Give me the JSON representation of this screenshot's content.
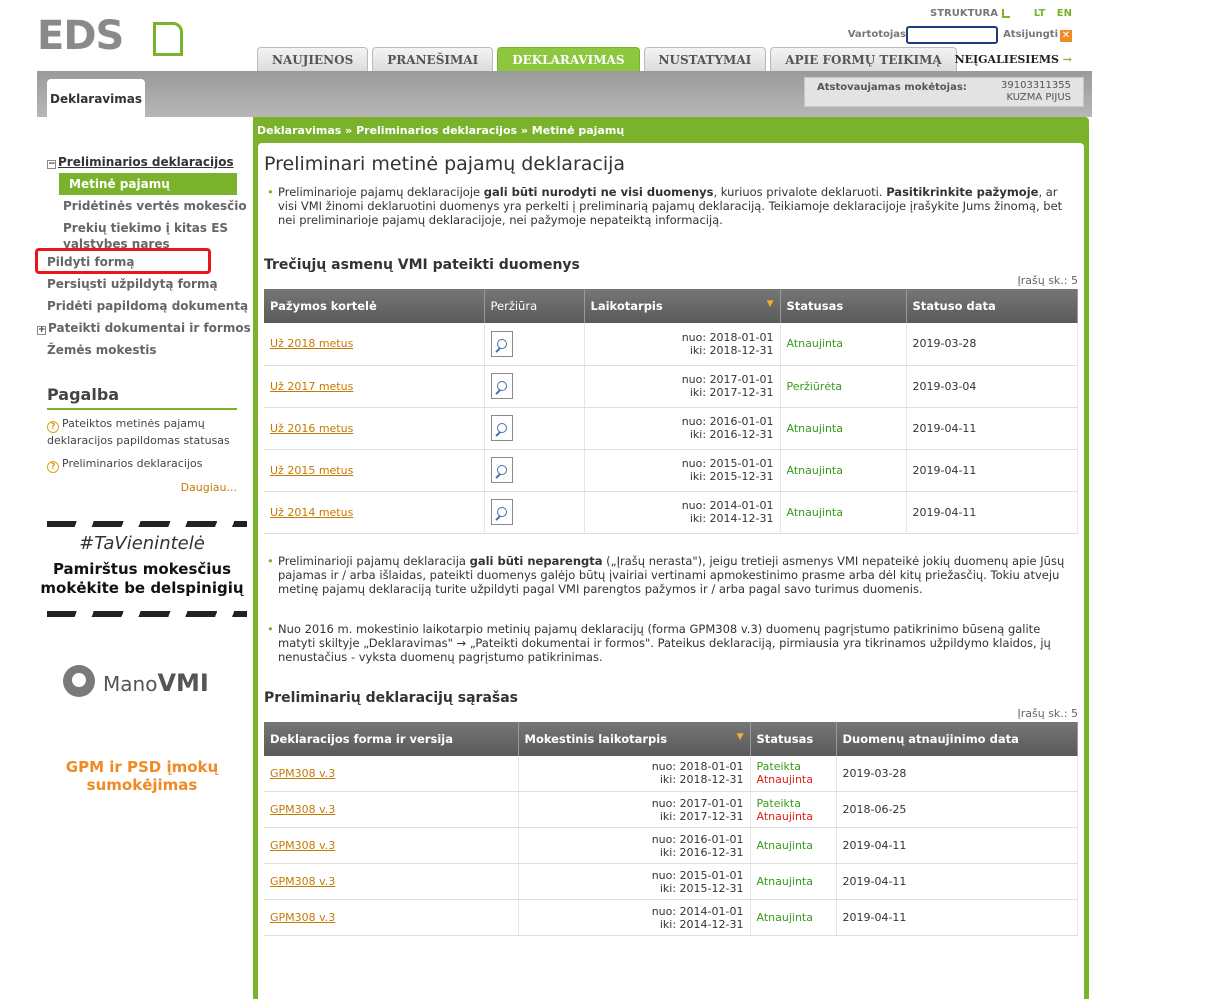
{
  "header": {
    "logo_text": "EDS",
    "struktura": "STRUKTURA",
    "lang_lt": "LT",
    "lang_en": "EN",
    "user_label": "Vartotojas",
    "logout": "Atsijungti",
    "tabs": [
      "NAUJIENOS",
      "PRANEŠIMAI",
      "DEKLARAVIMAS",
      "NUSTATYMAI",
      "APIE FORMŲ TEIKIMĄ"
    ],
    "active_tab": "DEKLARAVIMAS",
    "neigaliesiems": "NEĮGALIESIEMS"
  },
  "band": {
    "tab": "Deklaravimas",
    "payer_label": "Atstovaujamas mokėtojas:",
    "payer_id": "39103311355",
    "payer_name": "KUZMA PIJUS"
  },
  "sidebar": {
    "items": [
      {
        "label": "Preliminarios deklaracijos",
        "type": "top",
        "toggle": "−"
      },
      {
        "label": "Metinė pajamų",
        "type": "active"
      },
      {
        "label": "Pridėtinės vertės mokesčio",
        "type": "sub"
      },
      {
        "label": "Prekių tiekimo į kitas ES valstybes nares",
        "type": "sub"
      },
      {
        "label": "Pildyti formą",
        "type": "plain"
      },
      {
        "label": "Persiųsti užpildytą formą",
        "type": "plain"
      },
      {
        "label": "Pridėti papildomą dokumentą",
        "type": "plain"
      },
      {
        "label": "Pateikti dokumentai ir formos",
        "type": "plain",
        "toggle": "+"
      },
      {
        "label": "Žemės mokestis",
        "type": "plain"
      }
    ],
    "help_title": "Pagalba",
    "help_links": [
      "Pateiktos metinės pajamų deklaracijos papildomas statusas",
      "Preliminarios deklaracijos"
    ],
    "more": "Daugiau...",
    "banner1_hashtag": "#TaVienintelė",
    "banner1_msg_line1": "Pamirštus mokesčius",
    "banner1_msg_line2": "mokėkite be delspinigių",
    "mano_prefix": "Mano",
    "mano_suffix": "VMI",
    "banner3_line1": "GPM ir PSD įmokų",
    "banner3_line2": "sumokėjimas"
  },
  "main": {
    "breadcrumb": "Deklaravimas » Preliminarios deklaracijos » Metinė pajamų",
    "title": "Preliminari metinė pajamų deklaracija",
    "para1": {
      "t1": "Preliminarioje pajamų deklaracijoje ",
      "b1": "gali būti nurodyti ne visi duomenys",
      "t2": ", kuriuos privalote deklaruoti. ",
      "b2": "Pasitikrinkite pažymoje",
      "t3": ", ar visi VMI žinomi deklaruotini duomenys yra perkelti į preliminarią pajamų deklaraciją. Teikiamoje deklaracijoje įrašykite Jums žinomą, bet nei preliminarioje pajamų deklaracijoje, nei pažymoje nepateiktą informaciją."
    },
    "section1_title": "Trečiųjų asmenų VMI pateikti duomenys",
    "section1_count": "Įrašų sk.: 5",
    "table1": {
      "headers": [
        "Pažymos kortelė",
        "Peržiūra",
        "Laikotarpis",
        "Statusas",
        "Statuso data"
      ],
      "rows": [
        {
          "link": "Už 2018 metus",
          "from": "nuo: 2018-01-01",
          "to": "iki: 2018-12-31",
          "status": "Atnaujinta",
          "date": "2019-03-28"
        },
        {
          "link": "Už 2017 metus",
          "from": "nuo: 2017-01-01",
          "to": "iki: 2017-12-31",
          "status": "Peržiūrėta",
          "date": "2019-03-04"
        },
        {
          "link": "Už 2016 metus",
          "from": "nuo: 2016-01-01",
          "to": "iki: 2016-12-31",
          "status": "Atnaujinta",
          "date": "2019-04-11"
        },
        {
          "link": "Už 2015 metus",
          "from": "nuo: 2015-01-01",
          "to": "iki: 2015-12-31",
          "status": "Atnaujinta",
          "date": "2019-04-11"
        },
        {
          "link": "Už 2014 metus",
          "from": "nuo: 2014-01-01",
          "to": "iki: 2014-12-31",
          "status": "Atnaujinta",
          "date": "2019-04-11"
        }
      ]
    },
    "para2": {
      "t1": "Preliminarioji pajamų deklaracija ",
      "b1": "gali būti neparengta",
      "t2": " („Įrašų nerasta\"), jeigu tretieji asmenys VMI nepateikė jokių duomenų apie Jūsų pajamas ir / arba išlaidas, pateikti duomenys galėjo būtų įvairiai vertinami apmokestinimo prasme arba dėl kitų priežasčių. Tokiu atveju metinę pajamų deklaraciją turite užpildyti pagal VMI parengtos pažymos ir / arba pagal savo turimus duomenis."
    },
    "para3": "Nuo 2016 m. mokestinio laikotarpio metinių pajamų deklaracijų (forma GPM308 v.3) duomenų pagrįstumo patikrinimo būseną galite matyti skiltyje „Deklaravimas\" → „Pateikti dokumentai ir formos\". Pateikus deklaraciją, pirmiausia yra tikrinamos užpildymo klaidos, jų nenustačius - vyksta duomenų pagrįstumo patikrinimas.",
    "section2_title": "Preliminarių deklaracijų sąrašas",
    "section2_count": "Įrašų sk.: 5",
    "table2": {
      "headers": [
        "Deklaracijos forma ir versija",
        "Mokestinis laikotarpis",
        "Statusas",
        "Duomenų atnaujinimo data"
      ],
      "rows": [
        {
          "link": "GPM308 v.3",
          "from": "nuo: 2018-01-01",
          "to": "iki: 2018-12-31",
          "status1": "Pateikta",
          "status2": "Atnaujinta",
          "date": "2019-03-28"
        },
        {
          "link": "GPM308 v.3",
          "from": "nuo: 2017-01-01",
          "to": "iki: 2017-12-31",
          "status1": "Pateikta",
          "status2": "Atnaujinta",
          "date": "2018-06-25"
        },
        {
          "link": "GPM308 v.3",
          "from": "nuo: 2016-01-01",
          "to": "iki: 2016-12-31",
          "status1": "Atnaujinta",
          "status2": "",
          "date": "2019-04-11"
        },
        {
          "link": "GPM308 v.3",
          "from": "nuo: 2015-01-01",
          "to": "iki: 2015-12-31",
          "status1": "Atnaujinta",
          "status2": "",
          "date": "2019-04-11"
        },
        {
          "link": "GPM308 v.3",
          "from": "nuo: 2014-01-01",
          "to": "iki: 2014-12-31",
          "status1": "Atnaujinta",
          "status2": "",
          "date": "2019-04-11"
        }
      ]
    }
  }
}
